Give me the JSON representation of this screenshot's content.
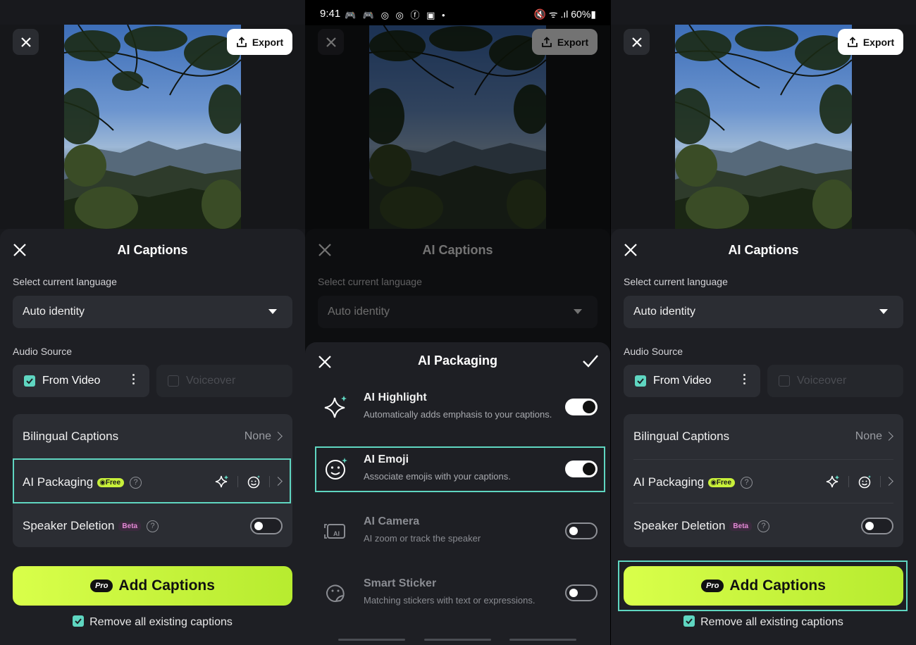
{
  "status_bar": {
    "time": "9:41",
    "app_icons": "🎮 🎮 ◎ ◎ ⓕ ▣ •",
    "right_text": "🔇 ᯤ .ıl 60%▮"
  },
  "video": {
    "export_label": "Export"
  },
  "captions_sheet": {
    "title": "AI Captions",
    "language_label": "Select current language",
    "language_value": "Auto identity",
    "audio_source_label": "Audio Source",
    "source_video": "From Video",
    "source_voiceover": "Voiceover",
    "rows": {
      "bilingual": {
        "label": "Bilingual Captions",
        "value": "None"
      },
      "packaging": {
        "label": "AI Packaging",
        "badge": "Free"
      },
      "speaker": {
        "label": "Speaker Deletion",
        "badge": "Beta"
      }
    },
    "add_button": {
      "pro": "Pro",
      "label": "Add Captions"
    },
    "remove_label": "Remove all existing captions"
  },
  "packaging_sheet": {
    "title": "AI Packaging",
    "items": [
      {
        "title": "AI Highlight",
        "desc": "Automatically adds emphasis to your captions.",
        "enabled": true
      },
      {
        "title": "AI Emoji",
        "desc": "Associate emojis with your captions.",
        "enabled": true
      },
      {
        "title": "AI Camera",
        "desc": "AI zoom or track the speaker",
        "enabled": false
      },
      {
        "title": "Smart Sticker",
        "desc": "Matching stickers with text or expressions.",
        "enabled": false
      }
    ]
  },
  "colors": {
    "accent": "#5fd6c1",
    "button_green": "#c8f03a",
    "sheet_bg": "#1e1f24"
  }
}
